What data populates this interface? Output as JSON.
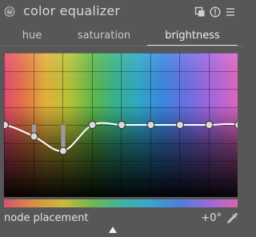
{
  "module": {
    "title": "color equalizer"
  },
  "tabs": [
    {
      "label": "hue",
      "active": false
    },
    {
      "label": "saturation",
      "active": false
    },
    {
      "label": "brightness",
      "active": true
    }
  ],
  "graph": {
    "nodes": [
      {
        "hue_index": 0,
        "value": 0.0
      },
      {
        "hue_index": 1,
        "value": -0.16
      },
      {
        "hue_index": 2,
        "value": -0.36
      },
      {
        "hue_index": 3,
        "value": 0.0
      },
      {
        "hue_index": 4,
        "value": 0.0
      },
      {
        "hue_index": 5,
        "value": 0.0
      },
      {
        "hue_index": 6,
        "value": 0.0
      },
      {
        "hue_index": 7,
        "value": 0.0
      }
    ],
    "grid_divisions": 8
  },
  "slider": {
    "label": "node placement",
    "value": "+0°"
  },
  "icons": {
    "power": "power-icon",
    "presets": "presets-icon",
    "reset": "reset-icon",
    "menu": "menu-icon",
    "picker": "color-picker-icon"
  },
  "colors": {
    "panel_bg": "#575757",
    "curve": "#ffffff",
    "node_fill": "#d9d9d9",
    "accent_text": "#e2e2e2"
  }
}
